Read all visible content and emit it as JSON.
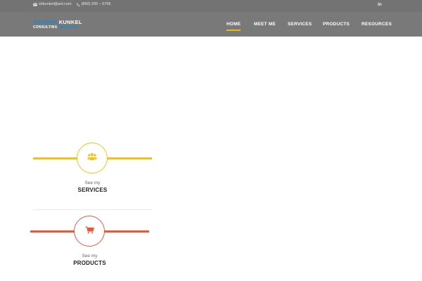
{
  "topbar": {
    "email": "shkunkel@aol.com",
    "phone": "(860) 205 – 5755",
    "social_label": "in",
    "email_icon": "envelope-icon",
    "phone_icon": "phone-icon",
    "social_icon": "linkedin-icon"
  },
  "logo": {
    "line1_part1": "SHARON",
    "line1_part2": "KUNKEL",
    "line2_part1": "CONSULTING",
    "line2_part2": "SERVICES"
  },
  "nav": {
    "items": [
      {
        "label": "HOME",
        "active": true
      },
      {
        "label": "MEET ME",
        "active": false
      },
      {
        "label": "SERVICES",
        "active": false
      },
      {
        "label": "PRODUCTS",
        "active": false
      },
      {
        "label": "RESOURCES",
        "active": false
      }
    ]
  },
  "features": [
    {
      "caption": "See my",
      "title": "SERVICES",
      "icon": "users-icon",
      "color": "#f0c419"
    },
    {
      "caption": "See my",
      "title": "PRODUCTS",
      "icon": "cart-icon",
      "color": "#e8583b"
    }
  ],
  "colors": {
    "header_bg": "#797979",
    "accent_yellow": "#f0c419",
    "accent_red": "#e8583b",
    "logo_blue": "#1a88d8"
  }
}
